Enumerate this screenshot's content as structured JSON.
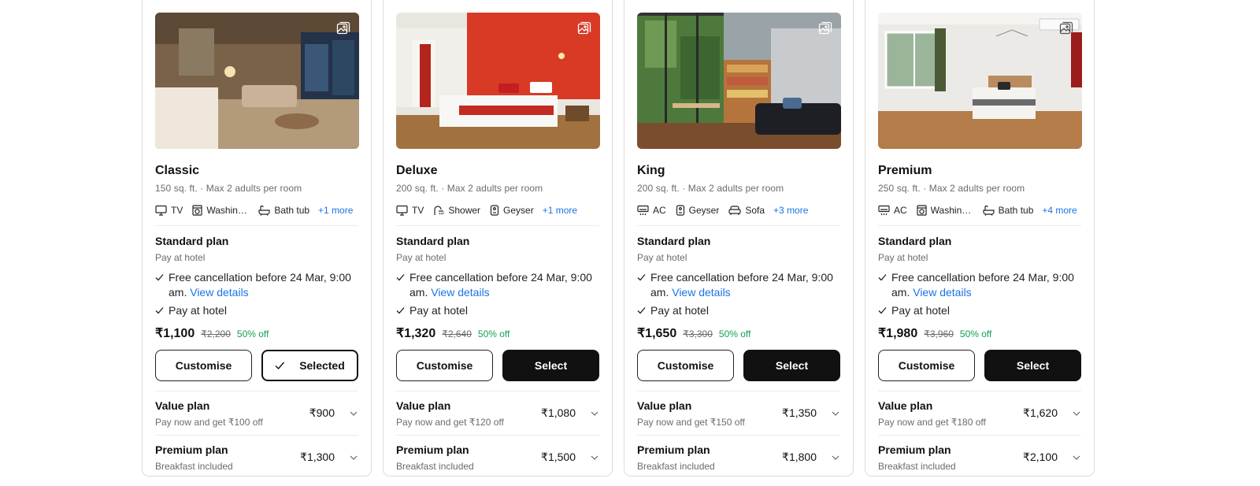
{
  "rooms": [
    {
      "name": "Classic",
      "size": "150 sq. ft.",
      "occupancy": "Max 2 adults per room",
      "amenities": [
        {
          "icon": "tv-icon",
          "label": "TV"
        },
        {
          "icon": "washing-machine-icon",
          "label": "Washing machine"
        },
        {
          "icon": "bathtub-icon",
          "label": "Bath tub"
        }
      ],
      "more": "+1 more",
      "plan": {
        "title": "Standard plan",
        "subtitle": "Pay at hotel",
        "cancel_text": "Free cancellation before 24 Mar, 9:00 am.",
        "view_details": "View details",
        "pay_text": "Pay at hotel"
      },
      "price": "₹1,100",
      "original_price": "₹2,200",
      "discount": "50% off",
      "customise_label": "Customise",
      "select_label": "Selected",
      "selected": true,
      "value_plan": {
        "title": "Value plan",
        "subtitle": "Pay now and get ₹100 off",
        "price": "₹900"
      },
      "premium_plan": {
        "title": "Premium plan",
        "subtitle": "Breakfast included",
        "price": "₹1,300"
      }
    },
    {
      "name": "Deluxe",
      "size": "200 sq. ft.",
      "occupancy": "Max 2 adults per room",
      "amenities": [
        {
          "icon": "tv-icon",
          "label": "TV"
        },
        {
          "icon": "shower-icon",
          "label": "Shower"
        },
        {
          "icon": "geyser-icon",
          "label": "Geyser"
        }
      ],
      "more": "+1 more",
      "plan": {
        "title": "Standard plan",
        "subtitle": "Pay at hotel",
        "cancel_text": "Free cancellation before 24 Mar, 9:00 am.",
        "view_details": "View details",
        "pay_text": "Pay at hotel"
      },
      "price": "₹1,320",
      "original_price": "₹2,640",
      "discount": "50% off",
      "customise_label": "Customise",
      "select_label": "Select",
      "selected": false,
      "value_plan": {
        "title": "Value plan",
        "subtitle": "Pay now and get ₹120 off",
        "price": "₹1,080"
      },
      "premium_plan": {
        "title": "Premium plan",
        "subtitle": "Breakfast included",
        "price": "₹1,500"
      }
    },
    {
      "name": "King",
      "size": "200 sq. ft.",
      "occupancy": "Max 2 adults per room",
      "amenities": [
        {
          "icon": "ac-icon",
          "label": "AC"
        },
        {
          "icon": "geyser-icon",
          "label": "Geyser"
        },
        {
          "icon": "sofa-icon",
          "label": "Sofa"
        }
      ],
      "more": "+3 more",
      "plan": {
        "title": "Standard plan",
        "subtitle": "Pay at hotel",
        "cancel_text": "Free cancellation before 24 Mar, 9:00 am.",
        "view_details": "View details",
        "pay_text": "Pay at hotel"
      },
      "price": "₹1,650",
      "original_price": "₹3,300",
      "discount": "50% off",
      "customise_label": "Customise",
      "select_label": "Select",
      "selected": false,
      "value_plan": {
        "title": "Value plan",
        "subtitle": "Pay now and get ₹150 off",
        "price": "₹1,350"
      },
      "premium_plan": {
        "title": "Premium plan",
        "subtitle": "Breakfast included",
        "price": "₹1,800"
      }
    },
    {
      "name": "Premium",
      "size": "250 sq. ft.",
      "occupancy": "Max 2 adults per room",
      "amenities": [
        {
          "icon": "ac-icon",
          "label": "AC"
        },
        {
          "icon": "washing-machine-icon",
          "label": "Washing machine"
        },
        {
          "icon": "bathtub-icon",
          "label": "Bath tub"
        }
      ],
      "more": "+4 more",
      "plan": {
        "title": "Standard plan",
        "subtitle": "Pay at hotel",
        "cancel_text": "Free cancellation before 24 Mar, 9:00 am.",
        "view_details": "View details",
        "pay_text": "Pay at hotel"
      },
      "price": "₹1,980",
      "original_price": "₹3,960",
      "discount": "50% off",
      "customise_label": "Customise",
      "select_label": "Select",
      "selected": false,
      "value_plan": {
        "title": "Value plan",
        "subtitle": "Pay now and get ₹180 off",
        "price": "₹1,620"
      },
      "premium_plan": {
        "title": "Premium plan",
        "subtitle": "Breakfast included",
        "price": "₹2,100"
      }
    }
  ],
  "colors": {
    "link": "#1a73e8",
    "discount": "#12a150",
    "primary_button": "#111111"
  }
}
